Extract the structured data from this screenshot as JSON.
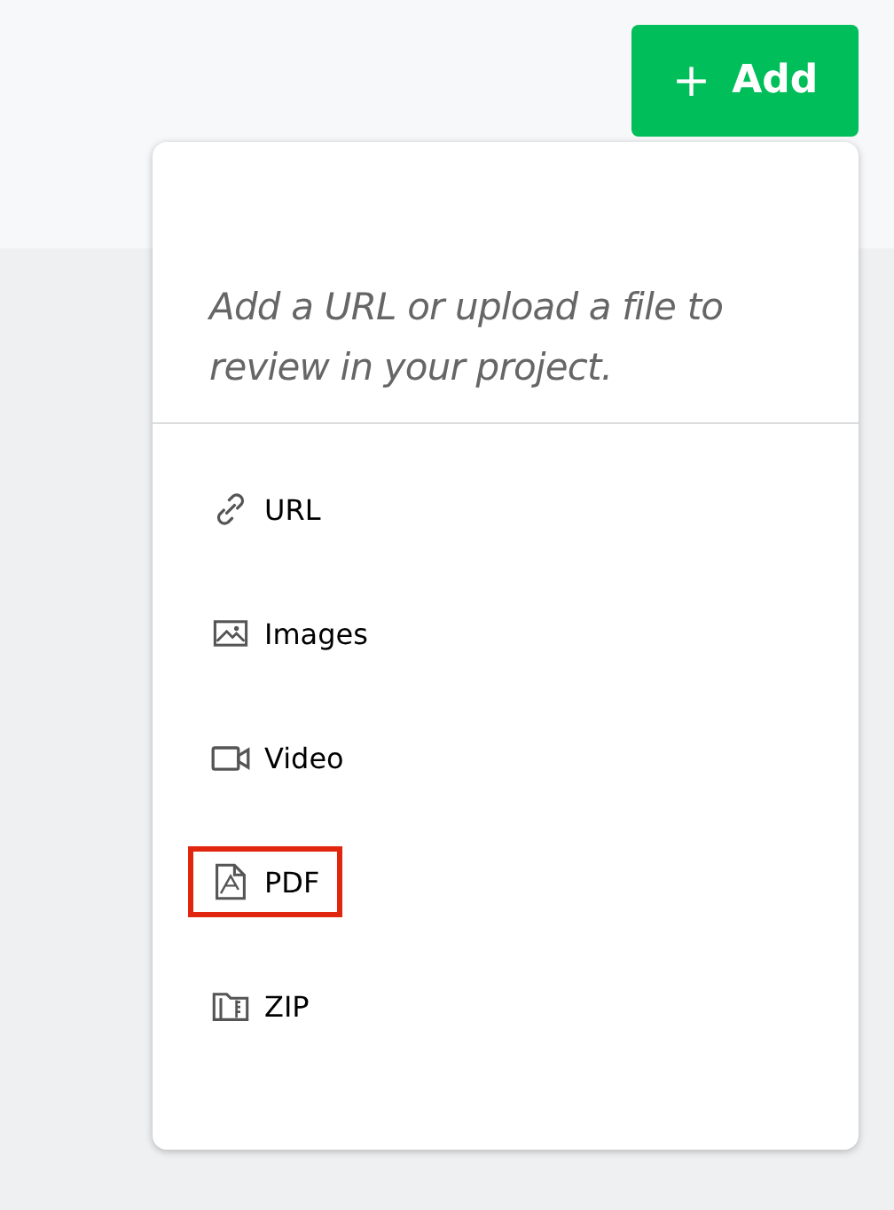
{
  "add_button": {
    "icon": "+",
    "label": "Add"
  },
  "menu": {
    "description": "Add a URL or upload a file to review in your project.",
    "items": [
      {
        "kind": "link",
        "label": "URL",
        "highlighted": false
      },
      {
        "kind": "image",
        "label": "Images",
        "highlighted": false
      },
      {
        "kind": "video",
        "label": "Video",
        "highlighted": false
      },
      {
        "kind": "pdf",
        "label": "PDF",
        "highlighted": true
      },
      {
        "kind": "zip",
        "label": "ZIP",
        "highlighted": false
      }
    ]
  }
}
